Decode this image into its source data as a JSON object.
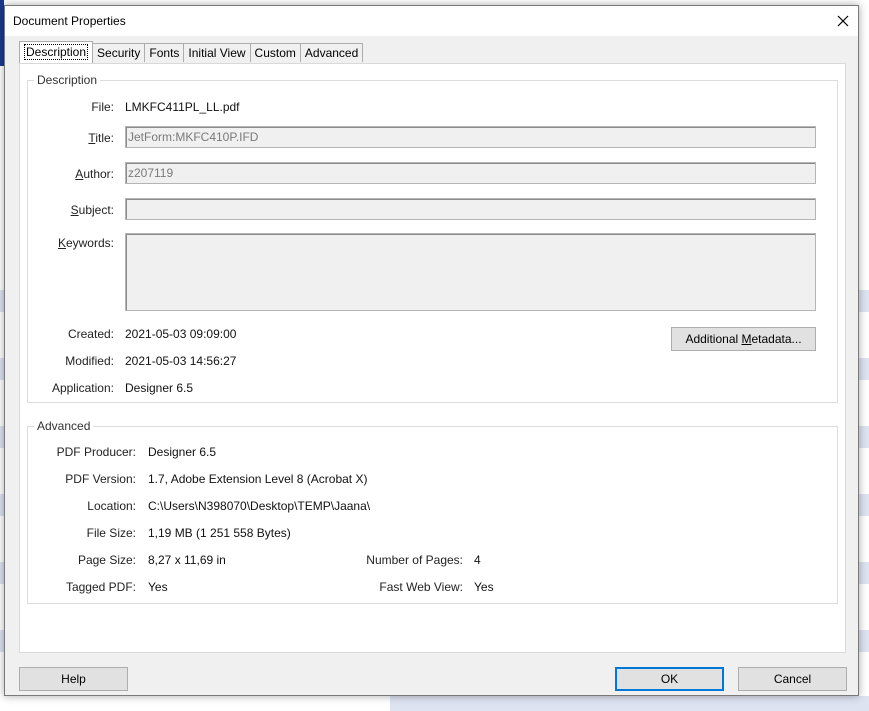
{
  "dialog": {
    "title": "Document Properties"
  },
  "tabs": [
    "Description",
    "Security",
    "Fonts",
    "Initial View",
    "Custom",
    "Advanced"
  ],
  "description_group": {
    "label": "Description",
    "file_label": "File:",
    "file_value": "LMKFC411PL_LL.pdf",
    "title_label": "Title:",
    "title_value": "JetForm:MKFC410P.IFD",
    "author_label": "Author:",
    "author_value": "z207119",
    "subject_label": "Subject:",
    "subject_value": "",
    "keywords_label": "Keywords:",
    "keywords_value": "",
    "created_label": "Created:",
    "created_value": "2021-05-03 09:09:00",
    "modified_label": "Modified:",
    "modified_value": "2021-05-03 14:56:27",
    "application_label": "Application:",
    "application_value": "Designer 6.5",
    "metadata_button": "Additional Metadata..."
  },
  "advanced_group": {
    "label": "Advanced",
    "producer_label": "PDF Producer:",
    "producer_value": "Designer 6.5",
    "version_label": "PDF Version:",
    "version_value": "1.7, Adobe Extension Level 8 (Acrobat X)",
    "location_label": "Location:",
    "location_value": "C:\\Users\\N398070\\Desktop\\TEMP\\Jaana\\",
    "filesize_label": "File Size:",
    "filesize_value": "1,19 MB (1 251 558 Bytes)",
    "pagesize_label": "Page Size:",
    "pagesize_value": "8,27 x 11,69 in",
    "numpages_label": "Number of Pages:",
    "numpages_value": "4",
    "tagged_label": "Tagged PDF:",
    "tagged_value": "Yes",
    "fastweb_label": "Fast Web View:",
    "fastweb_value": "Yes"
  },
  "footer": {
    "help": "Help",
    "ok": "OK",
    "cancel": "Cancel"
  },
  "colors": {
    "accent": "#0078d7",
    "field_bg": "#f0f0f0",
    "dialog_bg": "#f0f0f0"
  }
}
